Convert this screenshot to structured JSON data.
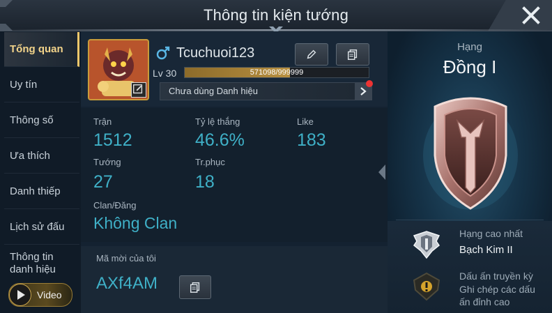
{
  "header": {
    "title": "Thông tin kiện tướng"
  },
  "sidebar": {
    "items": [
      {
        "label": "Tổng quan"
      },
      {
        "label": "Uy tín"
      },
      {
        "label": "Thông số"
      },
      {
        "label": "Ưa thích"
      },
      {
        "label": "Danh thiếp"
      },
      {
        "label": "Lịch sử đấu"
      },
      {
        "label": "Thông tin danh hiệu"
      }
    ],
    "video_label": "Video"
  },
  "profile": {
    "name": "Tcuchuoi123",
    "level_label": "Lv 30",
    "xp_text": "571098/999999",
    "xp_fraction": 0.571,
    "title_text": "Chưa dùng Danh hiệu"
  },
  "stats": {
    "matches_label": "Trận",
    "matches_value": "1512",
    "winrate_label": "Tỷ lệ thắng",
    "winrate_value": "46.6%",
    "like_label": "Like",
    "like_value": "183",
    "heroes_label": "Tướng",
    "heroes_value": "27",
    "skins_label": "Tr.phục",
    "skins_value": "18",
    "clan_label": "Clan/Đăng",
    "clan_value": "Không Clan"
  },
  "invite": {
    "label": "Mã mời của tôi",
    "code": "AXf4AM"
  },
  "rank": {
    "label": "Hạng",
    "name": "Đồng I",
    "highest_label": "Hạng cao nhất",
    "highest_value": "Bạch Kim II",
    "mark_label": "Dấu ấn truyền kỳ",
    "mark_desc_1": "Ghi chép các dấu",
    "mark_desc_2": "ấn đỉnh cao"
  },
  "colors": {
    "accent_gold": "#f1c86b",
    "stat_cyan": "#3fb0c7",
    "notify_red": "#ee3333"
  }
}
